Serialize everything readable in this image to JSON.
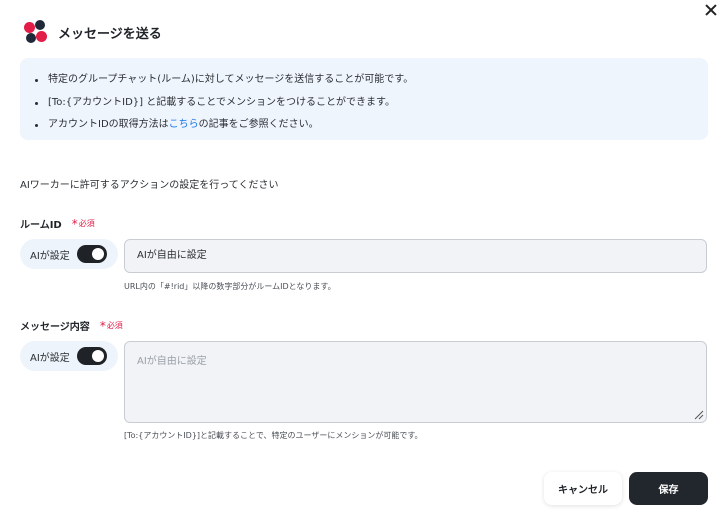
{
  "dialog": {
    "title": "メッセージを送る",
    "close_icon": "close-icon"
  },
  "info": {
    "item1": "特定のグループチャット(ルーム)に対してメッセージを送信することが可能です。",
    "item2": "[To:{アカウントID}] と記載することでメンションをつけることができます。",
    "item3_pre": "アカウントIDの取得方法は",
    "item3_link": "こちら",
    "item3_post": "の記事をご参照ください。"
  },
  "description": "AIワーカーに許可するアクションの設定を行ってください",
  "room_field": {
    "label": "ルームID",
    "required_mark": "*",
    "required_text": "必須",
    "toggle_label": "AIが設定",
    "toggle_on": true,
    "value": "AIが自由に設定",
    "hint": "URL内の「#!rid」以降の数字部分がルームIDとなります。"
  },
  "message_field": {
    "label": "メッセージ内容",
    "required_mark": "*",
    "required_text": "必須",
    "toggle_label": "AIが設定",
    "toggle_on": true,
    "placeholder": "AIが自由に設定",
    "hint": "[To:{アカウントID}]と記載することで、特定のユーザーにメンションが可能です。"
  },
  "buttons": {
    "cancel": "キャンセル",
    "save": "保存"
  },
  "colors": {
    "accent_red": "#e11d48",
    "link_blue": "#1a73e8",
    "info_bg": "#eef5fd",
    "primary_dark": "#22272e"
  }
}
